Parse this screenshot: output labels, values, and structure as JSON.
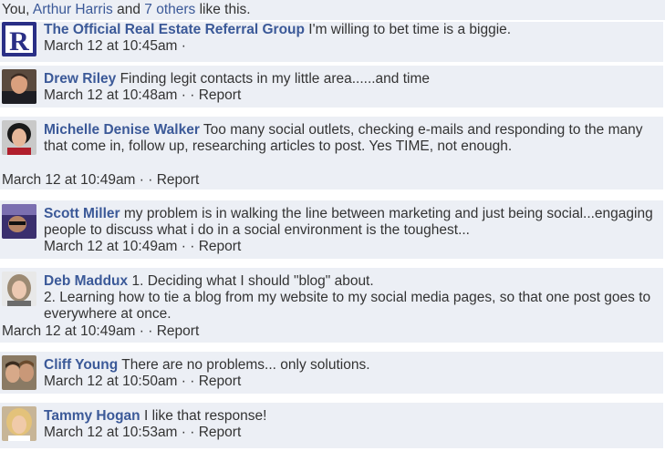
{
  "likes": {
    "you": "You, ",
    "friend": "Arthur Harris",
    "and": " and ",
    "others": "7 others",
    "tail": " like this."
  },
  "comments": [
    {
      "author": "The Official Real Estate Referral Group",
      "text": "I'm willing to bet time is a biggie.",
      "time": "March 12 at 10:45am",
      "sep": " · ",
      "report": ""
    },
    {
      "author": "Drew Riley",
      "text": "Finding legit contacts in my little area......and time",
      "time": "March 12 at 10:48am",
      "sep": " ·  · ",
      "report": "Report"
    },
    {
      "author": "Michelle Denise Walker",
      "text": "Too many social outlets, checking e-mails and responding to the many that come in, follow up, researching articles to post. Yes TIME, not enough.",
      "time": "March 12 at 10:49am",
      "sep": " ·  · ",
      "report": "Report"
    },
    {
      "author": "Scott Miller",
      "text": "my problem is in walking the line between marketing and just being social...engaging people to discuss what i do in a social environment is the toughest...",
      "time": "March 12 at 10:49am",
      "sep": " ·  · ",
      "report": "Report"
    },
    {
      "author": "Deb Maddux",
      "text": "1. Deciding what I should \"blog\" about.",
      "text2": "2. Learning how to tie a blog from my website to my social media pages, so that one post goes to everywhere at once.",
      "time": "March 12 at 10:49am",
      "sep": " ·  · ",
      "report": "Report"
    },
    {
      "author": "Cliff Young",
      "text": "There are no problems... only solutions.",
      "time": "March 12 at 10:50am",
      "sep": " ·  · ",
      "report": "Report"
    },
    {
      "author": "Tammy Hogan",
      "text": "I like that response!",
      "time": "March 12 at 10:53am",
      "sep": " ·  · ",
      "report": "Report"
    }
  ],
  "colors": {
    "link": "#3b5998",
    "bg": "#eceff5",
    "logo": "#2a2f86"
  }
}
